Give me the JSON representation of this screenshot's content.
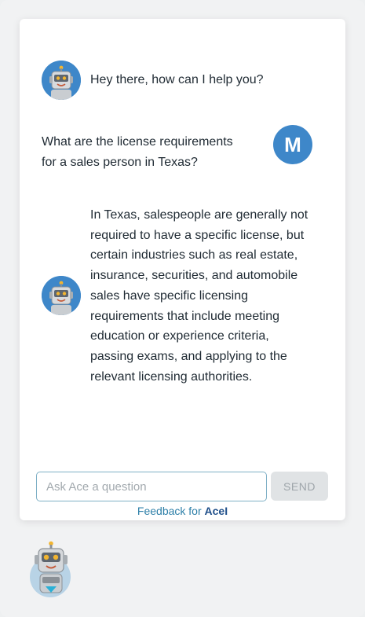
{
  "conversation": {
    "messages": [
      {
        "sender": "bot",
        "text": "Hey there, how can I help you?"
      },
      {
        "sender": "user",
        "avatar_initial": "M",
        "lines": [
          "What are the license requirements",
          "for a sales person in Texas?"
        ]
      },
      {
        "sender": "bot",
        "lines": [
          "In Texas, salespeople are generally not",
          "required to have a specific license, but",
          "certain industries such as real estate,",
          "insurance, securities, and automobile",
          "sales have specific licensing",
          "requirements that include meeting",
          "education or experience criteria,",
          "passing exams, and applying to the",
          "relevant licensing authorities."
        ]
      }
    ]
  },
  "composer": {
    "placeholder": "Ask Ace a question",
    "send_label": "SEND"
  },
  "footer": {
    "feedback_prefix": "Feedback for ",
    "brand": "AceI"
  },
  "colors": {
    "avatar_blue": "#3e87c9",
    "link_blue": "#2d7fa8"
  },
  "icons": {
    "bot_avatar": "robot-avatar-icon",
    "launcher": "robot-launcher-icon"
  }
}
